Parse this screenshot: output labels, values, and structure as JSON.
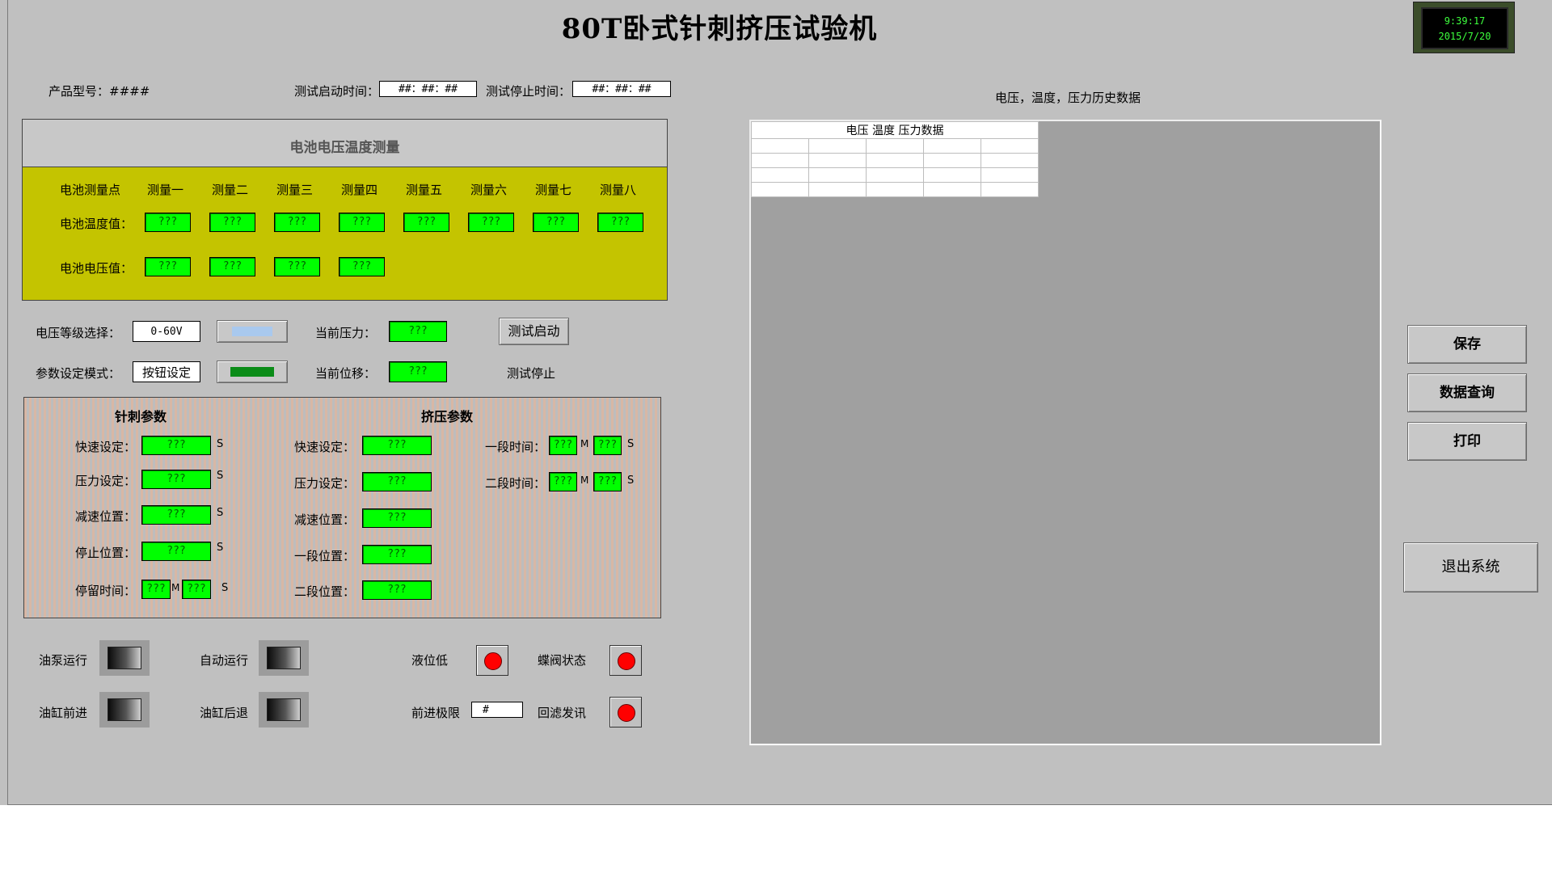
{
  "title": "80T卧式针刺挤压试验机",
  "clock": {
    "time": "9:39:17",
    "date": "2015/7/20"
  },
  "header": {
    "product_model_label": "产品型号：####",
    "start_time_label": "测试启动时间：",
    "start_time_value": "##：##：##",
    "stop_time_label": "测试停止时间：",
    "stop_time_value": "##：##：##"
  },
  "measurement": {
    "title": "电池电压温度测量",
    "point_label": "电池测量点",
    "columns": [
      "测量一",
      "测量二",
      "测量三",
      "测量四",
      "测量五",
      "测量六",
      "测量七",
      "测量八"
    ],
    "temp_label": "电池温度值：",
    "temp_values": [
      "???",
      "???",
      "???",
      "???",
      "???",
      "???",
      "???",
      "???"
    ],
    "volt_label": "电池电压值：",
    "volt_values": [
      "???",
      "???",
      "???",
      "???"
    ]
  },
  "controls": {
    "voltage_level_label": "电压等级选择：",
    "voltage_level_value": "0-60V",
    "param_mode_label": "参数设定模式：",
    "param_mode_value": "按钮设定",
    "current_pressure_label": "当前压力：",
    "current_pressure_value": "???",
    "current_disp_label": "当前位移：",
    "current_disp_value": "???",
    "test_start_button": "测试启动",
    "test_stop_label": "测试停止"
  },
  "needle": {
    "title": "针刺参数",
    "fast_label": "快速设定：",
    "fast_value": "???",
    "fast_unit": "S",
    "pressure_label": "压力设定：",
    "pressure_value": "???",
    "pressure_unit": "S",
    "decel_label": "减速位置：",
    "decel_value": "???",
    "decel_unit": "S",
    "stop_label": "停止位置：",
    "stop_value": "???",
    "stop_unit": "S",
    "dwell_label": "停留时间：",
    "dwell_m": "???",
    "dwell_m_unit": "M",
    "dwell_s": "???",
    "dwell_s_unit": "S"
  },
  "squeeze": {
    "title": "挤压参数",
    "fast_label": "快速设定：",
    "fast_value": "???",
    "pressure_label": "压力设定：",
    "pressure_value": "???",
    "decel_label": "减速位置：",
    "decel_value": "???",
    "pos1_label": "一段位置：",
    "pos1_value": "???",
    "pos2_label": "二段位置：",
    "pos2_value": "???",
    "time1_label": "一段时间：",
    "time1_m": "???",
    "time1_s": "???",
    "time2_label": "二段时间：",
    "time2_m": "???",
    "time2_s": "???",
    "m_unit": "M",
    "s_unit": "S"
  },
  "status": {
    "oil_pump": "油泵运行",
    "auto_run": "自动运行",
    "cyl_forward": "油缸前进",
    "cyl_back": "油缸后退",
    "level_low": "液位低",
    "butterfly": "蝶阀状态",
    "forward_limit": "前进极限",
    "forward_limit_value": "#",
    "filter_alarm": "回滤发讯"
  },
  "history": {
    "heading": "电压，温度，压力历史数据",
    "table_caption": "电压 温度 压力数据"
  },
  "side_buttons": {
    "save": "保存",
    "query": "数据查询",
    "print": "打印",
    "exit": "退出系统"
  }
}
